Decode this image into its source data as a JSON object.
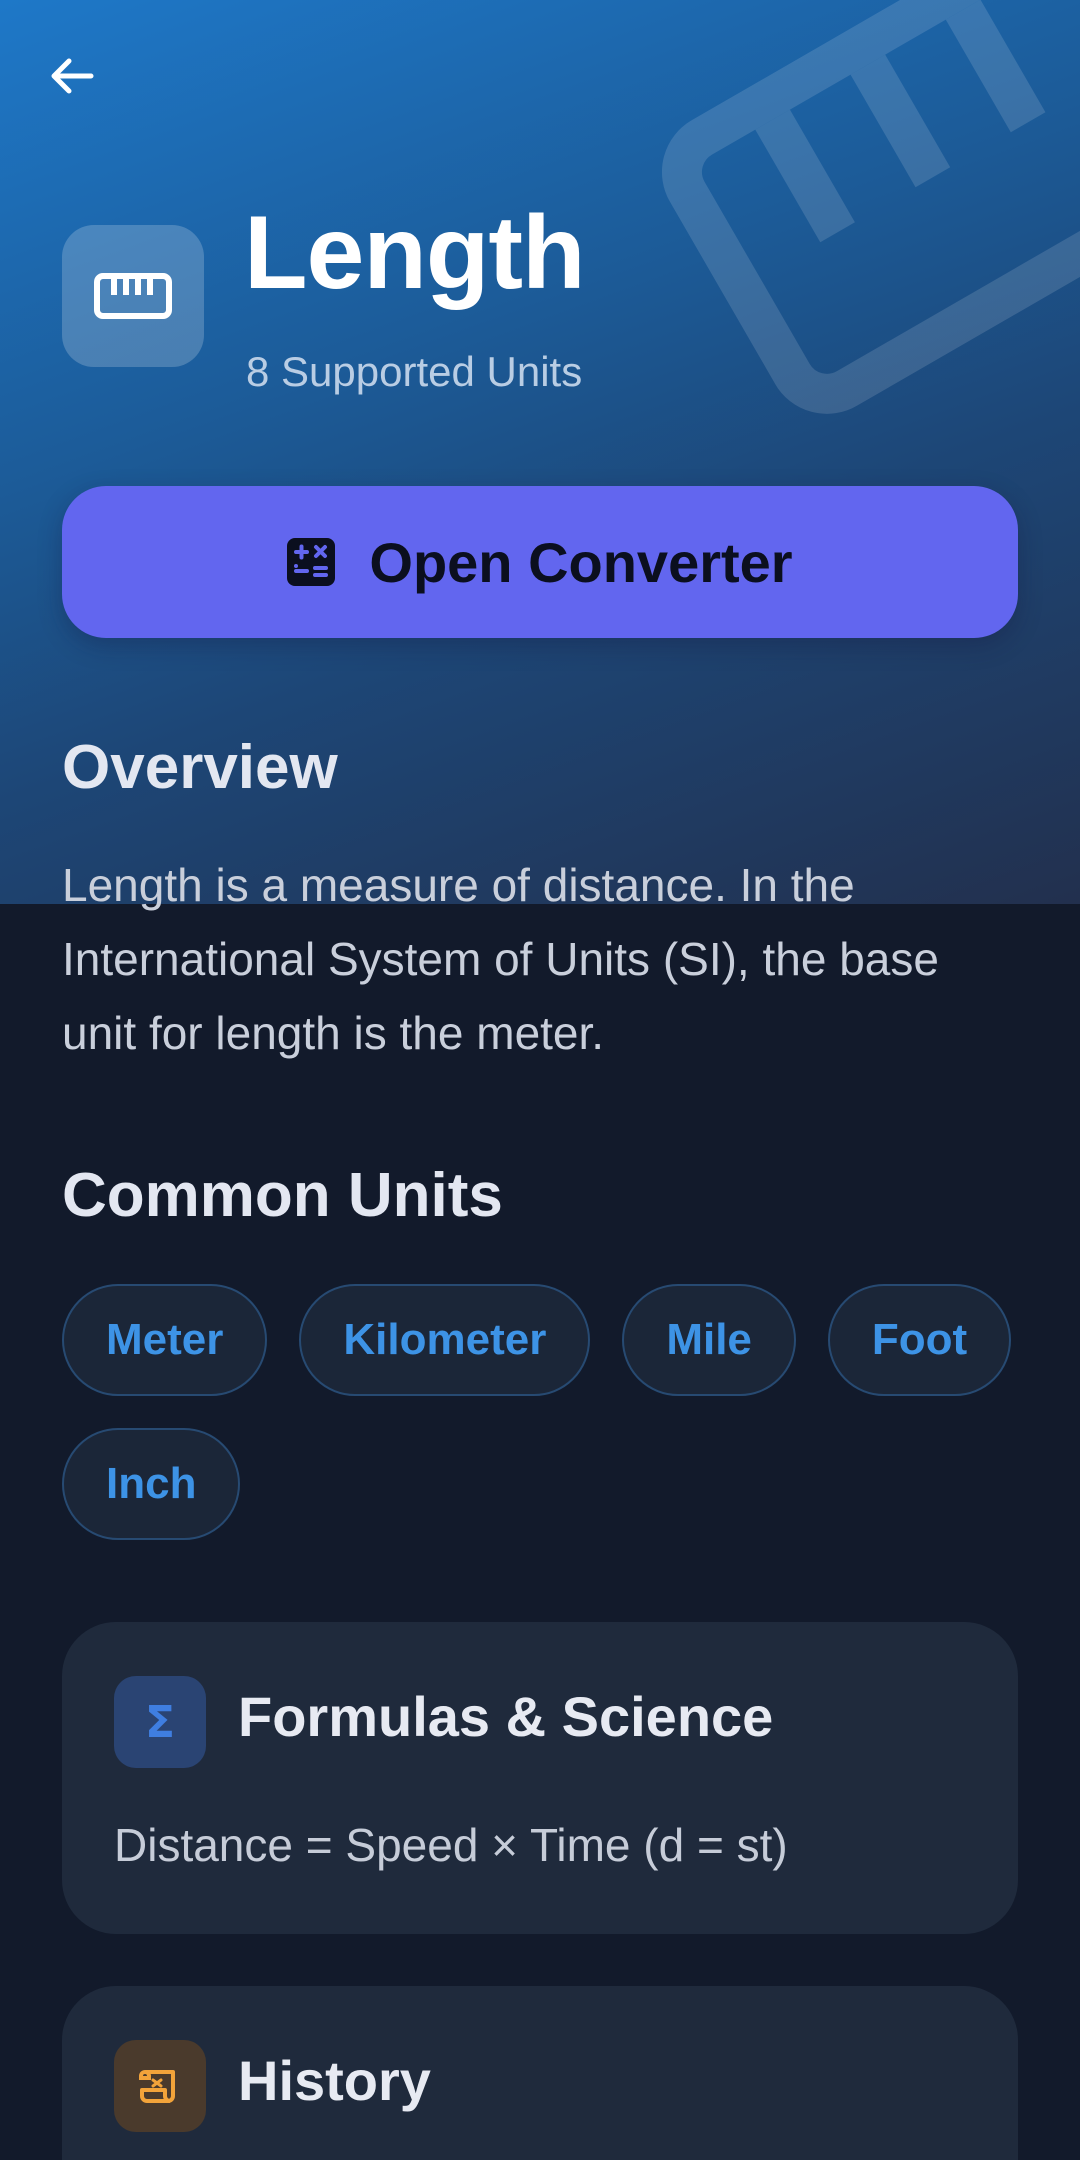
{
  "header": {
    "title": "Length",
    "subtitle": "8 Supported Units",
    "back_icon": "arrow-left-icon",
    "category_icon": "ruler-icon"
  },
  "actions": {
    "open_converter_label": "Open Converter",
    "open_converter_icon": "calculator-icon"
  },
  "overview": {
    "heading": "Overview",
    "text": "Length is a measure of distance. In the International System of Units (SI), the base unit for length is the meter."
  },
  "common_units": {
    "heading": "Common Units",
    "units": [
      "Meter",
      "Kilometer",
      "Mile",
      "Foot",
      "Inch"
    ]
  },
  "formulas": {
    "title": "Formulas & Science",
    "icon": "sigma-icon",
    "text": "Distance = Speed × Time (d = st)"
  },
  "history": {
    "title": "History",
    "icon": "scroll-icon"
  },
  "colors": {
    "accent_button": "#6266ef",
    "chip_text": "#3d93e6",
    "background": "#121a2b",
    "card": "#1f2a3c",
    "sigma_icon": "#3f7ee0",
    "history_icon": "#f2a33a"
  }
}
